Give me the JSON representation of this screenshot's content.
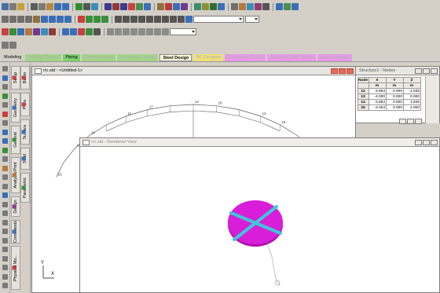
{
  "toolbar": {
    "row1": [
      {
        "icon": "save-icon",
        "color": "#4a6fa5"
      },
      {
        "icon": "print-icon",
        "color": "#7b7b7b"
      },
      {
        "icon": "open-icon",
        "color": "#c9a13a"
      },
      {
        "icon": "cut-icon",
        "color": "#5b5b5b"
      },
      {
        "icon": "copy-icon",
        "color": "#7b7b7b"
      },
      {
        "icon": "paste-icon",
        "color": "#b88a3a"
      },
      {
        "icon": "undo-icon",
        "color": "#3a6fb8"
      },
      {
        "icon": "redo-icon",
        "color": "#3a6fb8"
      },
      {
        "icon": "select-icon",
        "color": "#2f8f2f"
      },
      {
        "icon": "pointer-icon",
        "color": "#555555"
      },
      {
        "icon": "grid-icon",
        "color": "#3a8fb8"
      },
      {
        "icon": "zoom-icon",
        "color": "#3a3a8f"
      },
      {
        "icon": "node-icon",
        "color": "#8f3a3a"
      },
      {
        "icon": "beam-icon",
        "color": "#3a3a8f"
      },
      {
        "icon": "plate-icon",
        "color": "#c94040"
      },
      {
        "icon": "solid-icon",
        "color": "#4a8f4a"
      },
      {
        "icon": "surface-icon",
        "color": "#3a6fb8"
      },
      {
        "icon": "support-icon",
        "color": "#8f6f3a"
      },
      {
        "icon": "load-icon",
        "color": "#b83a3a"
      },
      {
        "icon": "member-icon",
        "color": "#3a6fb8"
      },
      {
        "icon": "spec-icon",
        "color": "#6f3a8f"
      },
      {
        "icon": "release-icon",
        "color": "#3a8f6f"
      },
      {
        "icon": "offset-icon",
        "color": "#8f8f3a"
      },
      {
        "icon": "run-icon",
        "color": "#2f6f2f"
      },
      {
        "icon": "post-icon",
        "color": "#3a6fb8"
      },
      {
        "icon": "report-icon",
        "color": "#6f6f6f"
      },
      {
        "icon": "snap-icon",
        "color": "#b8793a"
      },
      {
        "icon": "mesh-icon",
        "color": "#3a8fb8"
      },
      {
        "icon": "dim-icon",
        "color": "#8f3a6f"
      },
      {
        "icon": "label-icon",
        "color": "#555555"
      },
      {
        "icon": "ortho-icon",
        "color": "#3a6fb8"
      },
      {
        "icon": "view-icon",
        "color": "#4a8f4a"
      },
      {
        "icon": "help-icon",
        "color": "#3a6fb8"
      }
    ],
    "row2": [
      {
        "icon": "rotate-x-icon",
        "color": "#6f6f6f"
      },
      {
        "icon": "rotate-y-icon",
        "color": "#6f6f6f"
      },
      {
        "icon": "rotate-z-icon",
        "color": "#6f6f6f"
      },
      {
        "icon": "pan-icon",
        "color": "#6f6f6f"
      },
      {
        "icon": "spin-icon",
        "color": "#8f6f3a"
      },
      {
        "icon": "arrow-left-icon",
        "color": "#3a6fb8"
      },
      {
        "icon": "arrow-right-icon",
        "color": "#3a6fb8"
      },
      {
        "icon": "arrow-up-icon",
        "color": "#3a6fb8"
      },
      {
        "icon": "arrow-down-icon",
        "color": "#3a6fb8"
      },
      {
        "icon": "iso-icon",
        "color": "#c94040"
      },
      {
        "icon": "front-icon",
        "color": "#3a8f3a"
      },
      {
        "icon": "side-icon",
        "color": "#3a8f3a"
      },
      {
        "icon": "top-icon",
        "color": "#3a8f3a"
      },
      {
        "icon": "zoom-in-icon",
        "color": "#555555"
      },
      {
        "icon": "zoom-out-icon",
        "color": "#555555"
      },
      {
        "icon": "zoom-window-icon",
        "color": "#555555"
      },
      {
        "icon": "zoom-all-icon",
        "color": "#555555"
      },
      {
        "icon": "pan-view-icon",
        "color": "#555555"
      },
      {
        "icon": "dynamic-zoom-icon",
        "color": "#555555"
      },
      {
        "icon": "previous-view-icon",
        "color": "#555555"
      },
      {
        "icon": "next-view-icon",
        "color": "#555555"
      },
      {
        "icon": "display-icon",
        "color": "#555555"
      },
      {
        "icon": "magnify-icon",
        "color": "#3a6fb8"
      }
    ],
    "row3": [
      {
        "icon": "beam-cursor-icon",
        "color": "#c94040"
      },
      {
        "icon": "node-cursor-icon",
        "color": "#3a8f3a"
      },
      {
        "icon": "plate-cursor-icon",
        "color": "#3a6fb8"
      },
      {
        "icon": "solid-cursor-icon",
        "color": "#b8793a"
      },
      {
        "icon": "surface-cursor-icon",
        "color": "#6f3a8f"
      },
      {
        "icon": "geometry-cursor-icon",
        "color": "#3a8fb8"
      },
      {
        "icon": "label-cursor-icon",
        "color": "#8f3a3a"
      },
      {
        "icon": "select-nodes-icon",
        "color": "#3a6fb8"
      },
      {
        "icon": "select-beams-icon",
        "color": "#3a6fb8"
      },
      {
        "icon": "select-plates-icon",
        "color": "#c94040"
      },
      {
        "icon": "select-solids-icon",
        "color": "#3a8f3a"
      },
      {
        "icon": "select-all-icon",
        "color": "#555555"
      },
      {
        "icon": "move-icon",
        "color": "#8a8a8a"
      },
      {
        "icon": "copy-translate-icon",
        "color": "#8a8a8a"
      },
      {
        "icon": "mirror-icon",
        "color": "#8a8a8a"
      },
      {
        "icon": "rotate-icon",
        "color": "#8a8a8a"
      },
      {
        "icon": "circular-repeat-icon",
        "color": "#8a8a8a"
      },
      {
        "icon": "insert-node-icon",
        "color": "#8a8a8a"
      },
      {
        "icon": "add-beam-icon",
        "color": "#8a8a8a"
      },
      {
        "icon": "add-plate-icon",
        "color": "#8a8a8a"
      }
    ],
    "row4": [
      {
        "icon": "view-left-icon",
        "color": "#7a7a7a"
      },
      {
        "icon": "view-right-icon",
        "color": "#7a7a7a"
      }
    ]
  },
  "workspace_tabs": [
    {
      "label": "Modeling",
      "active": false,
      "color": "#000000",
      "bg": "#d4d0c8"
    },
    {
      "label": "Building Planner",
      "active": false,
      "color": "#b0b0b0",
      "bg": "#a4d48a"
    },
    {
      "label": "Piping",
      "active": false,
      "color": "#000000",
      "bg": "#7fd06f"
    },
    {
      "label": "Postprocessing",
      "active": false,
      "color": "#b0b0b0",
      "bg": "#a4d48a"
    },
    {
      "label": "Foundation Design",
      "active": false,
      "color": "#b0b0b0",
      "bg": "#a4d48a"
    },
    {
      "label": "Steel Design",
      "active": true,
      "color": "#000000",
      "bg": "#fffde0"
    },
    {
      "label": "RC Designer",
      "active": false,
      "color": "#b0b0b0",
      "bg": "#f0e07a"
    },
    {
      "label": "Connection Design",
      "active": false,
      "color": "#b0b0b0",
      "bg": "#e89ae8"
    },
    {
      "label": "Advanced Slab Design",
      "active": false,
      "color": "#b0b0b0",
      "bg": "#e89ae8"
    },
    {
      "label": "Earth Retaining",
      "active": false,
      "color": "#b0b0b0",
      "bg": "#e89ae8"
    }
  ],
  "page_controls": [
    {
      "label": "Setup",
      "dot": "#c94040"
    },
    {
      "label": "Geometry",
      "dot": "#3a6fb8"
    },
    {
      "label": "General",
      "dot": "#3a8f3a"
    },
    {
      "label": "Analysis/Print",
      "dot": "#b8793a"
    },
    {
      "label": "Design",
      "dot": "#8f3a8f"
    },
    {
      "label": "Commands",
      "dot": "#3a6fb8"
    },
    {
      "label": "Physical Mo...",
      "dot": "#c94040"
    }
  ],
  "sub_tabs": [
    {
      "label": "Beam",
      "dot": "#c94040"
    },
    {
      "label": "Plate",
      "dot": "#c94040"
    },
    {
      "label": "Surface",
      "dot": "#3a6fb8"
    },
    {
      "label": "Solid",
      "dot": "#3a6fb8"
    },
    {
      "label": "Parametric",
      "dot": "#3a8f3a"
    }
  ],
  "main_window": {
    "title": "rrc.std - <Untitled-1>",
    "node_labels": [
      "10",
      "11",
      "12",
      "13",
      "14",
      "15",
      "16",
      "17",
      "18",
      "19"
    ],
    "axis_y": "Y",
    "axis_x": "X"
  },
  "rendered_window": {
    "title": "rrc.std - Rendered View",
    "disc_color": "#d81ed8",
    "beam_color": "#3ec8d8"
  },
  "table_window": {
    "title": "Structure1 - Nodes",
    "headers": [
      "Node",
      "X",
      "Y",
      "Z"
    ],
    "units": [
      "",
      "m",
      "m",
      "m"
    ],
    "rows": [
      [
        "12",
        "-3.884",
        "0.000",
        "-1.835"
      ],
      [
        "13",
        "-4.000",
        "0.000",
        "0.000"
      ],
      [
        "14",
        "-3.884",
        "0.000",
        "1.835"
      ],
      [
        "15",
        "-3.464",
        "0.000",
        "2.000"
      ]
    ]
  }
}
